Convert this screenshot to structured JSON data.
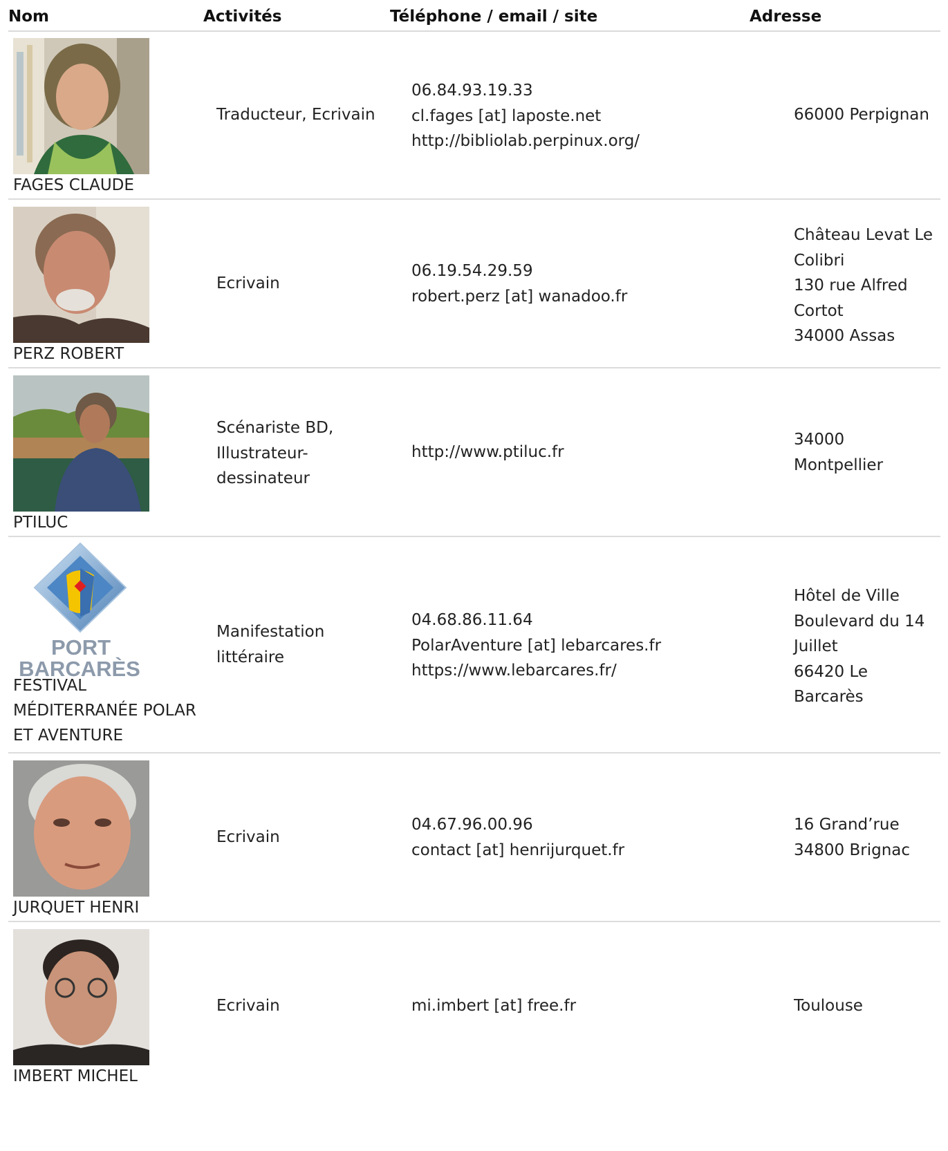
{
  "headers": {
    "nom": "Nom",
    "activites": "Activités",
    "contact": "Téléphone / email / site",
    "adresse": "Adresse"
  },
  "rows": [
    {
      "name": "FAGES CLAUDE",
      "photo_icon": "portrait-photo",
      "activity": [
        "Traducteur, Ecrivain"
      ],
      "contact": [
        "06.84.93.19.33",
        "cl.fages [at] laposte.net",
        "http://bibliolab.perpinux.org/"
      ],
      "address": [
        "66000 Perpignan"
      ]
    },
    {
      "name": "PERZ ROBERT",
      "photo_icon": "portrait-photo",
      "activity": [
        "Ecrivain"
      ],
      "contact": [
        "06.19.54.29.59",
        "robert.perz [at] wanadoo.fr"
      ],
      "address": [
        "Château Levat Le",
        "Colibri",
        "130 rue Alfred",
        "Cortot",
        "34000 Assas"
      ]
    },
    {
      "name": "PTILUC",
      "photo_icon": "portrait-photo",
      "activity": [
        "Scénariste BD,",
        "Illustrateur-",
        "dessinateur"
      ],
      "contact": [
        "http://www.ptiluc.fr"
      ],
      "address": [
        "34000",
        "Montpellier"
      ]
    },
    {
      "name": "FESTIVAL MÉDITERRANÉE POLAR ET AVENTURE",
      "name_lines": [
        "FESTIVAL",
        "MÉDITERRANÉE POLAR",
        "ET AVENTURE"
      ],
      "photo_icon": "port-barcares-logo",
      "logo_text": [
        "PORT",
        "BARCARÈS"
      ],
      "activity": [
        "Manifestation",
        "littéraire"
      ],
      "contact": [
        "04.68.86.11.64",
        "PolarAventure [at] lebarcares.fr",
        "https://www.lebarcares.fr/"
      ],
      "address": [
        "Hôtel de Ville",
        "Boulevard du 14",
        "Juillet",
        "66420 Le",
        "Barcarès"
      ]
    },
    {
      "name": "JURQUET HENRI",
      "photo_icon": "portrait-photo",
      "activity": [
        "Ecrivain"
      ],
      "contact": [
        "04.67.96.00.96",
        "contact [at] henrijurquet.fr"
      ],
      "address": [
        "16 Grand’rue",
        "34800 Brignac"
      ]
    },
    {
      "name": "IMBERT MICHEL",
      "photo_icon": "portrait-photo",
      "activity": [
        "Ecrivain"
      ],
      "contact": [
        "mi.imbert [at] free.fr"
      ],
      "address": [
        "Toulouse"
      ]
    }
  ],
  "colors": {
    "text": "#222222",
    "divider": "#dcdcdc",
    "logo_blue": "#5a8fc4",
    "logo_yellow": "#f5c400",
    "logo_red": "#e02020"
  }
}
